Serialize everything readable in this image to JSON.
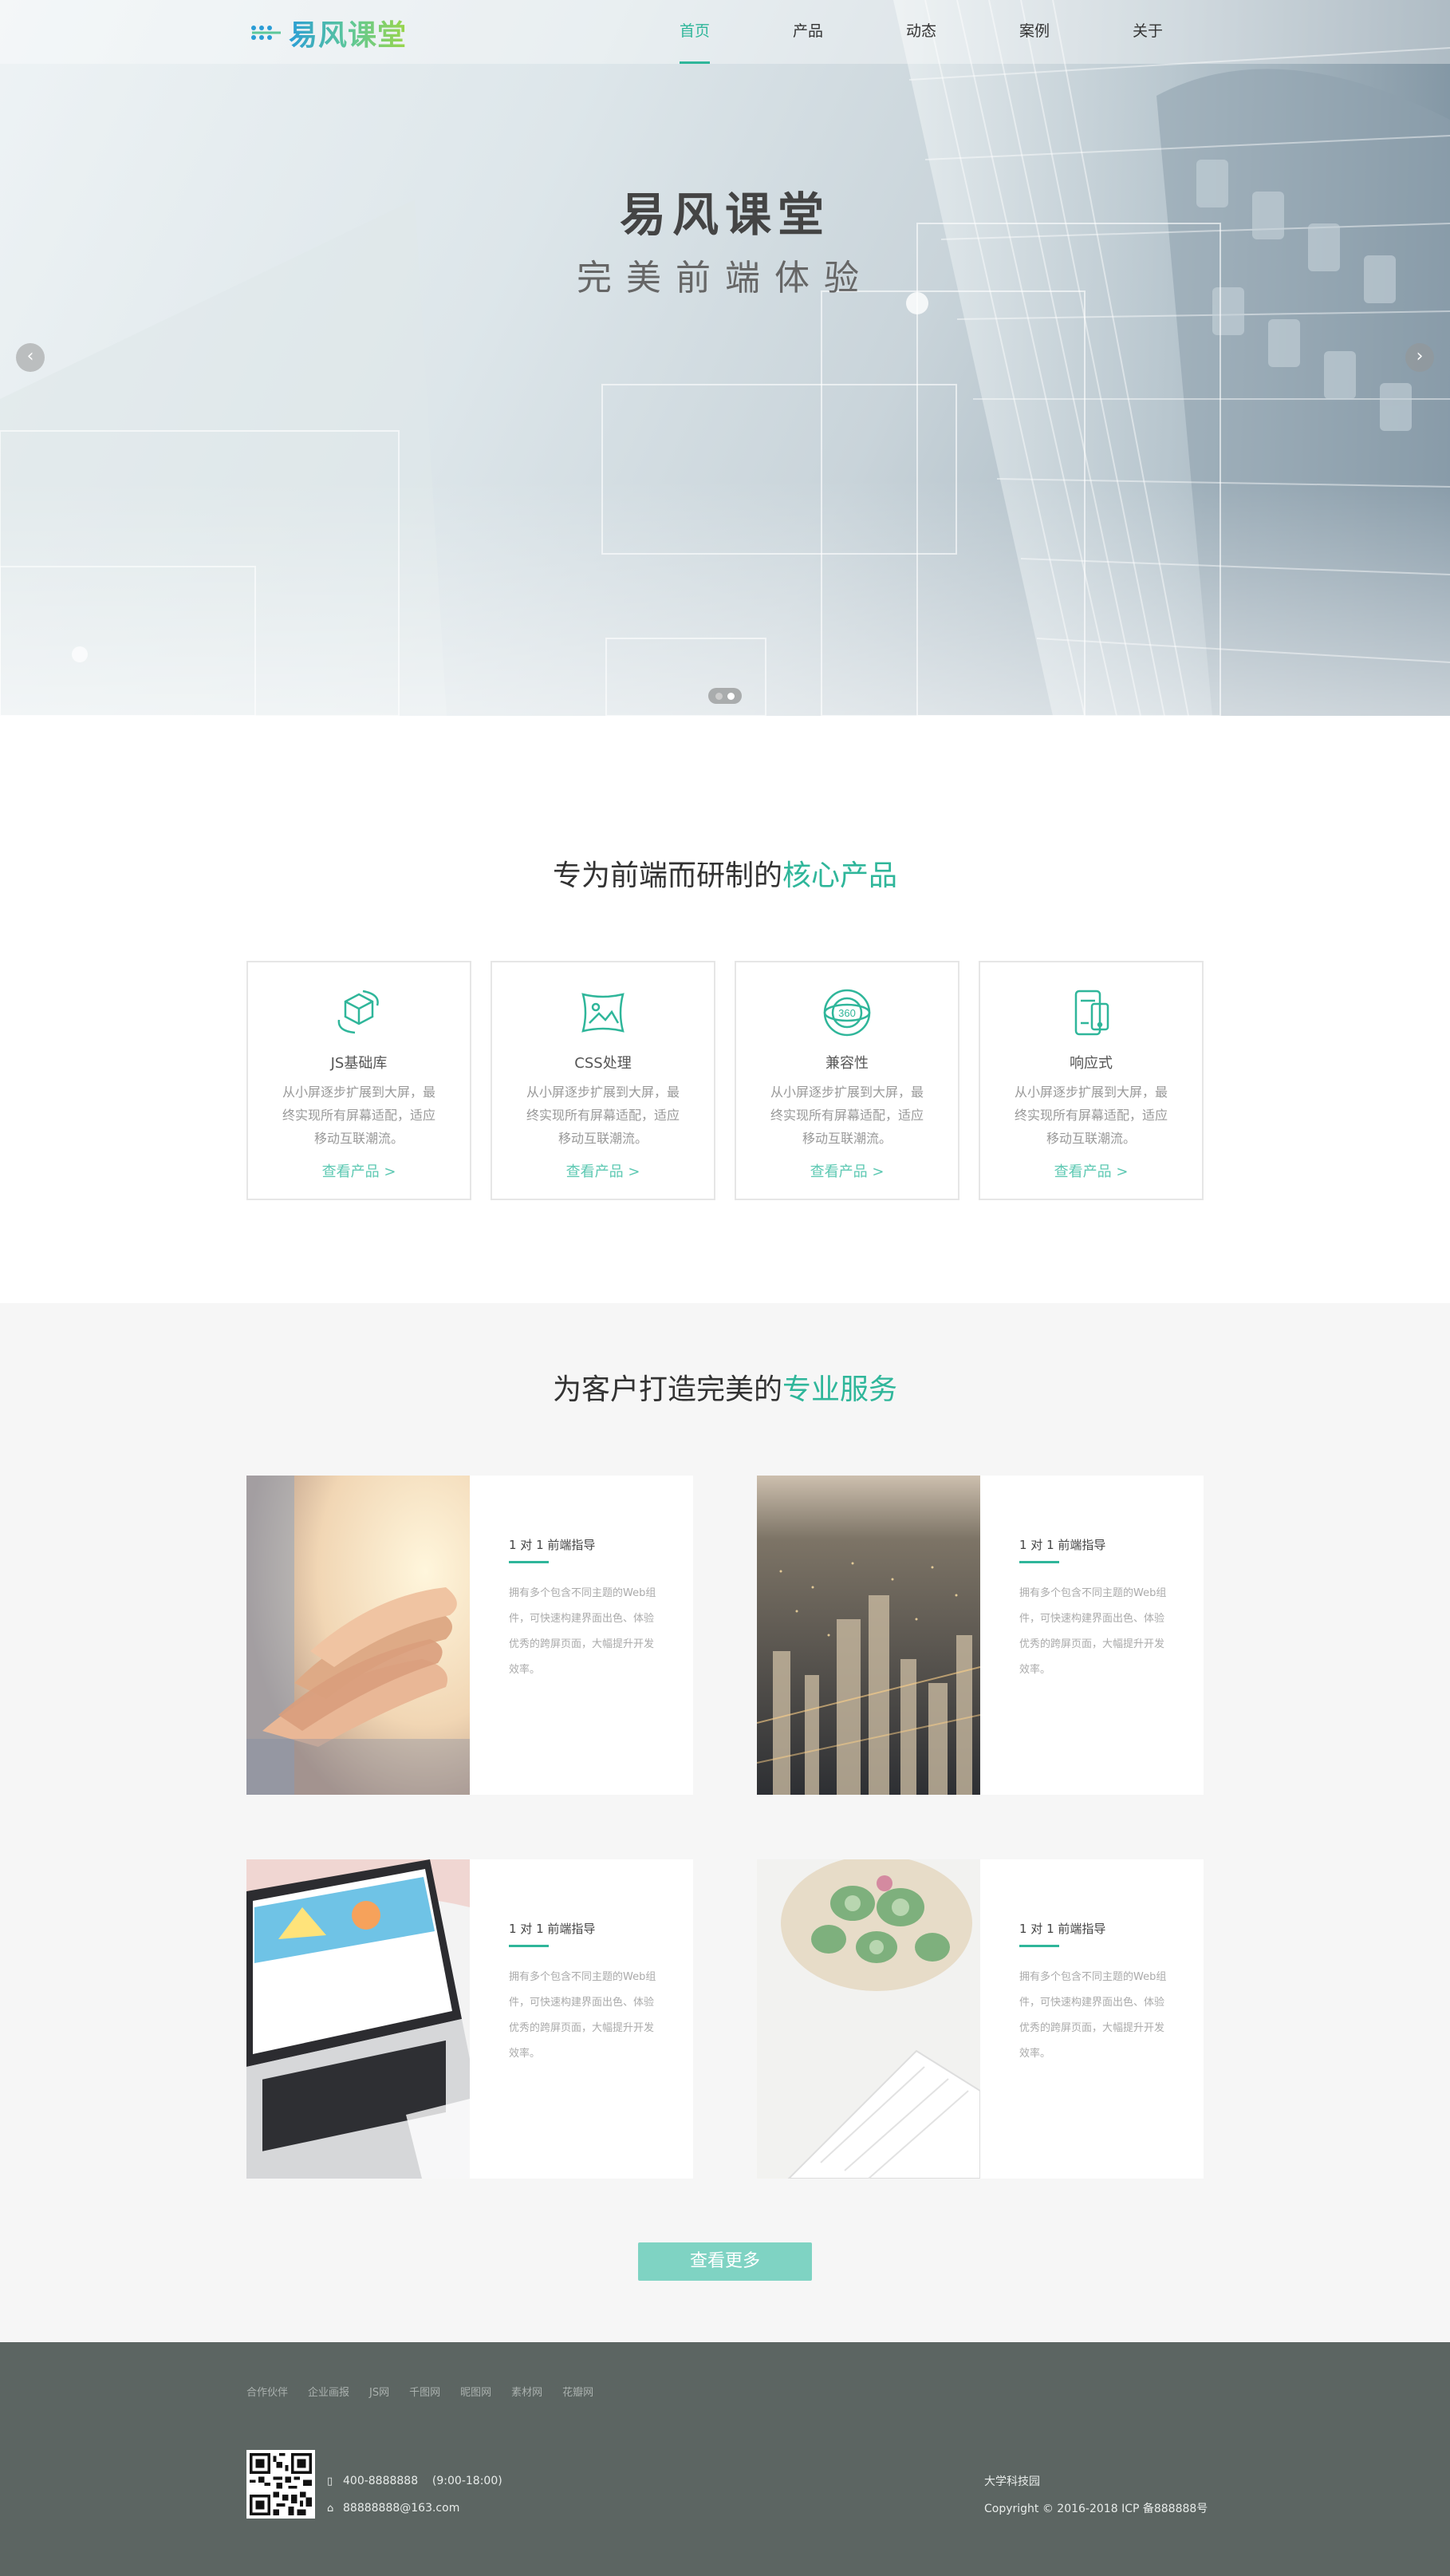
{
  "header": {
    "logo_text": "易风课堂",
    "nav": [
      {
        "label": "首页",
        "active": true
      },
      {
        "label": "产品",
        "active": false
      },
      {
        "label": "动态",
        "active": false
      },
      {
        "label": "案例",
        "active": false
      },
      {
        "label": "关于",
        "active": false
      }
    ]
  },
  "hero": {
    "title": "易风课堂",
    "subtitle": "完美前端体验",
    "prev_icon": "chevron-left-icon",
    "next_icon": "chevron-right-icon",
    "slides_count": 2,
    "active_slide": 2
  },
  "products": {
    "title_prefix": "专为前端而研制的",
    "title_highlight": "核心产品",
    "items": [
      {
        "name": "JS基础库",
        "icon": "cube-icon",
        "desc": "从小屏逐步扩展到大屏，最终实现所有屏幕适配，适应移动互联潮流。",
        "more": "查看产品 >"
      },
      {
        "name": "CSS处理",
        "icon": "image-frame-icon",
        "desc": "从小屏逐步扩展到大屏，最终实现所有屏幕适配，适应移动互联潮流。",
        "more": "查看产品 >"
      },
      {
        "name": "兼容性",
        "icon": "360-icon",
        "desc": "从小屏逐步扩展到大屏，最终实现所有屏幕适配，适应移动互联潮流。",
        "more": "查看产品 >"
      },
      {
        "name": "响应式",
        "icon": "responsive-devices-icon",
        "desc": "从小屏逐步扩展到大屏，最终实现所有屏幕适配，适应移动互联潮流。",
        "more": "查看产品 >"
      }
    ]
  },
  "services": {
    "title_prefix": "为客户打造完美的",
    "title_highlight": "专业服务",
    "items": [
      {
        "title": "1 对 1 前端指导",
        "desc": "拥有多个包含不同主题的Web组件，可快速构建界面出色、体验优秀的跨屏页面，大幅提升开发效率。"
      },
      {
        "title": "1 对 1 前端指导",
        "desc": "拥有多个包含不同主题的Web组件，可快速构建界面出色、体验优秀的跨屏页面，大幅提升开发效率。"
      },
      {
        "title": "1 对 1 前端指导",
        "desc": "拥有多个包含不同主题的Web组件，可快速构建界面出色、体验优秀的跨屏页面，大幅提升开发效率。"
      },
      {
        "title": "1 对 1 前端指导",
        "desc": "拥有多个包含不同主题的Web组件，可快速构建界面出色、体验优秀的跨屏页面，大幅提升开发效率。"
      }
    ],
    "more_button": "查看更多"
  },
  "footer": {
    "links": [
      "合作伙伴",
      "企业画报",
      "JS网",
      "千图网",
      "昵图网",
      "素材网",
      "花瓣网"
    ],
    "phone": "400-8888888    (9:00-18:00)",
    "email": "88888888@163.com",
    "company": "大学科技园",
    "copyright": "Copyright © 2016-2018  ICP 备888888号"
  },
  "colors": {
    "accent": "#2fb69a",
    "button": "#7fd3c3",
    "footer_bg": "#5c6562",
    "services_bg": "#f6f6f6"
  }
}
